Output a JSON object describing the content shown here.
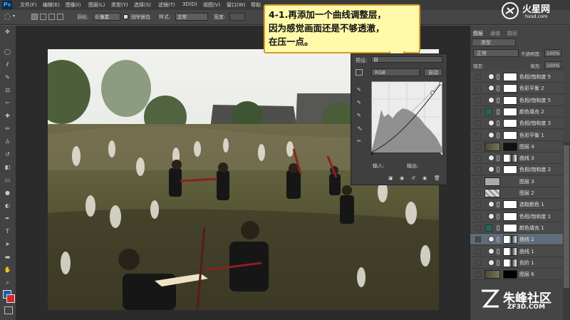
{
  "menu": [
    "文件(F)",
    "编辑(E)",
    "图像(I)",
    "图层(L)",
    "类型(Y)",
    "选择(S)",
    "滤镜(T)",
    "3D(D)",
    "视图(V)",
    "窗口(W)",
    "帮助"
  ],
  "options": {
    "feather_label": "羽化:",
    "feather_value": "0 像素",
    "antialias_label": "消除锯齿",
    "style_label": "样式:",
    "style_value": "正常",
    "width_label": "宽度:"
  },
  "callout": {
    "text": "4-1.再添加一个曲线调整层，\n因为感觉画面还是不够透澈，\n在压一点。"
  },
  "curves_panel": {
    "preset_label": "预设:",
    "preset_value": "自",
    "channel": "RGB",
    "auto_button": "自动",
    "input_label": "输入:",
    "output_label": "输出:"
  },
  "layers_panel": {
    "tabs": [
      "图层",
      "通道",
      "路径"
    ],
    "kind_filter": "类型",
    "blend_mode": "正常",
    "opacity_label": "不透明度:",
    "opacity_value": "100%",
    "lock_label": "锁定:",
    "fill_label": "填充:",
    "fill_value": "100%",
    "rows": [
      {
        "name": "色相/饱和度 5",
        "type": "adjust"
      },
      {
        "name": "色彩平衡 2",
        "type": "adjust"
      },
      {
        "name": "色相/饱和度 5",
        "type": "adjust"
      },
      {
        "name": "颜色填充 2",
        "type": "fill"
      },
      {
        "name": "色相/饱和度 3",
        "type": "adjust"
      },
      {
        "name": "色彩平衡 1",
        "type": "adjust"
      },
      {
        "name": "图层 4",
        "type": "pixel"
      },
      {
        "name": "曲线 3",
        "type": "adjust"
      },
      {
        "name": "色相/饱和度 2",
        "type": "adjust"
      },
      {
        "name": "图层 3",
        "type": "pixel"
      },
      {
        "name": "图层 2",
        "type": "pixel"
      },
      {
        "name": "选取颜色 1",
        "type": "adjust"
      },
      {
        "name": "色相/饱和度 1",
        "type": "adjust"
      },
      {
        "name": "颜色填充 1",
        "type": "fill"
      },
      {
        "name": "曲线 2",
        "type": "adjust"
      },
      {
        "name": "曲线 1",
        "type": "adjust"
      },
      {
        "name": "色阶 1",
        "type": "adjust"
      },
      {
        "name": "图层 6",
        "type": "pixel"
      }
    ]
  },
  "watermarks": {
    "top_right": "火星网",
    "top_right_sub": "hxsd.com",
    "bottom_right": "朱峰社区",
    "bottom_right_sub": "ZF3D.COM"
  },
  "colors": {
    "callout_bg": "#fff9a9",
    "callout_border": "#d89a2a",
    "selection": "#5f6c7c",
    "fill_layer": "#1a6b5a"
  }
}
